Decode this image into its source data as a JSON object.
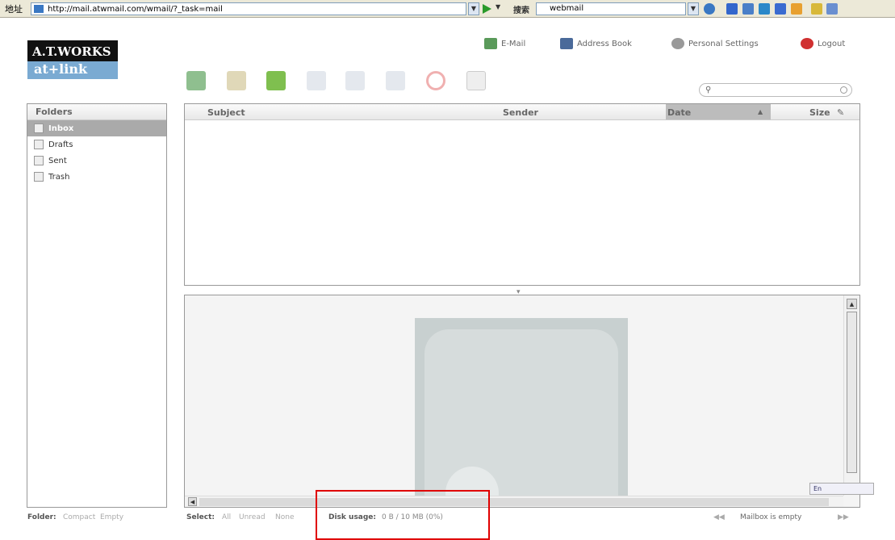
{
  "browser": {
    "address_label": "地址",
    "url": "http://mail.atwmail.com/wmail/?_task=mail",
    "search_label": "搜索",
    "search_value": "webmail"
  },
  "logo": {
    "line1": "A.T.WORKS",
    "line2": "at+link"
  },
  "topnav": {
    "email": "E-Mail",
    "address_book": "Address Book",
    "settings": "Personal Settings",
    "logout": "Logout"
  },
  "folders": {
    "header": "Folders",
    "items": [
      {
        "label": "Inbox",
        "selected": true
      },
      {
        "label": "Drafts",
        "selected": false
      },
      {
        "label": "Sent",
        "selected": false
      },
      {
        "label": "Trash",
        "selected": false
      }
    ]
  },
  "message_list": {
    "columns": {
      "subject": "Subject",
      "sender": "Sender",
      "date": "Date",
      "size": "Size"
    }
  },
  "footer": {
    "folder_label": "Folder:",
    "compact": "Compact",
    "empty": "Empty",
    "select_label": "Select:",
    "select_all": "All",
    "select_unread": "Unread",
    "select_none": "None",
    "disk_label": "Disk usage:",
    "disk_value": "0 B / 10 MB (0%)",
    "mailbox_status": "Mailbox is empty"
  },
  "ime": {
    "label": "En"
  },
  "colors": {
    "selected_folder": "#aaaaaa",
    "logo_band": "#7aaad2",
    "highlight_box": "#e00000"
  }
}
